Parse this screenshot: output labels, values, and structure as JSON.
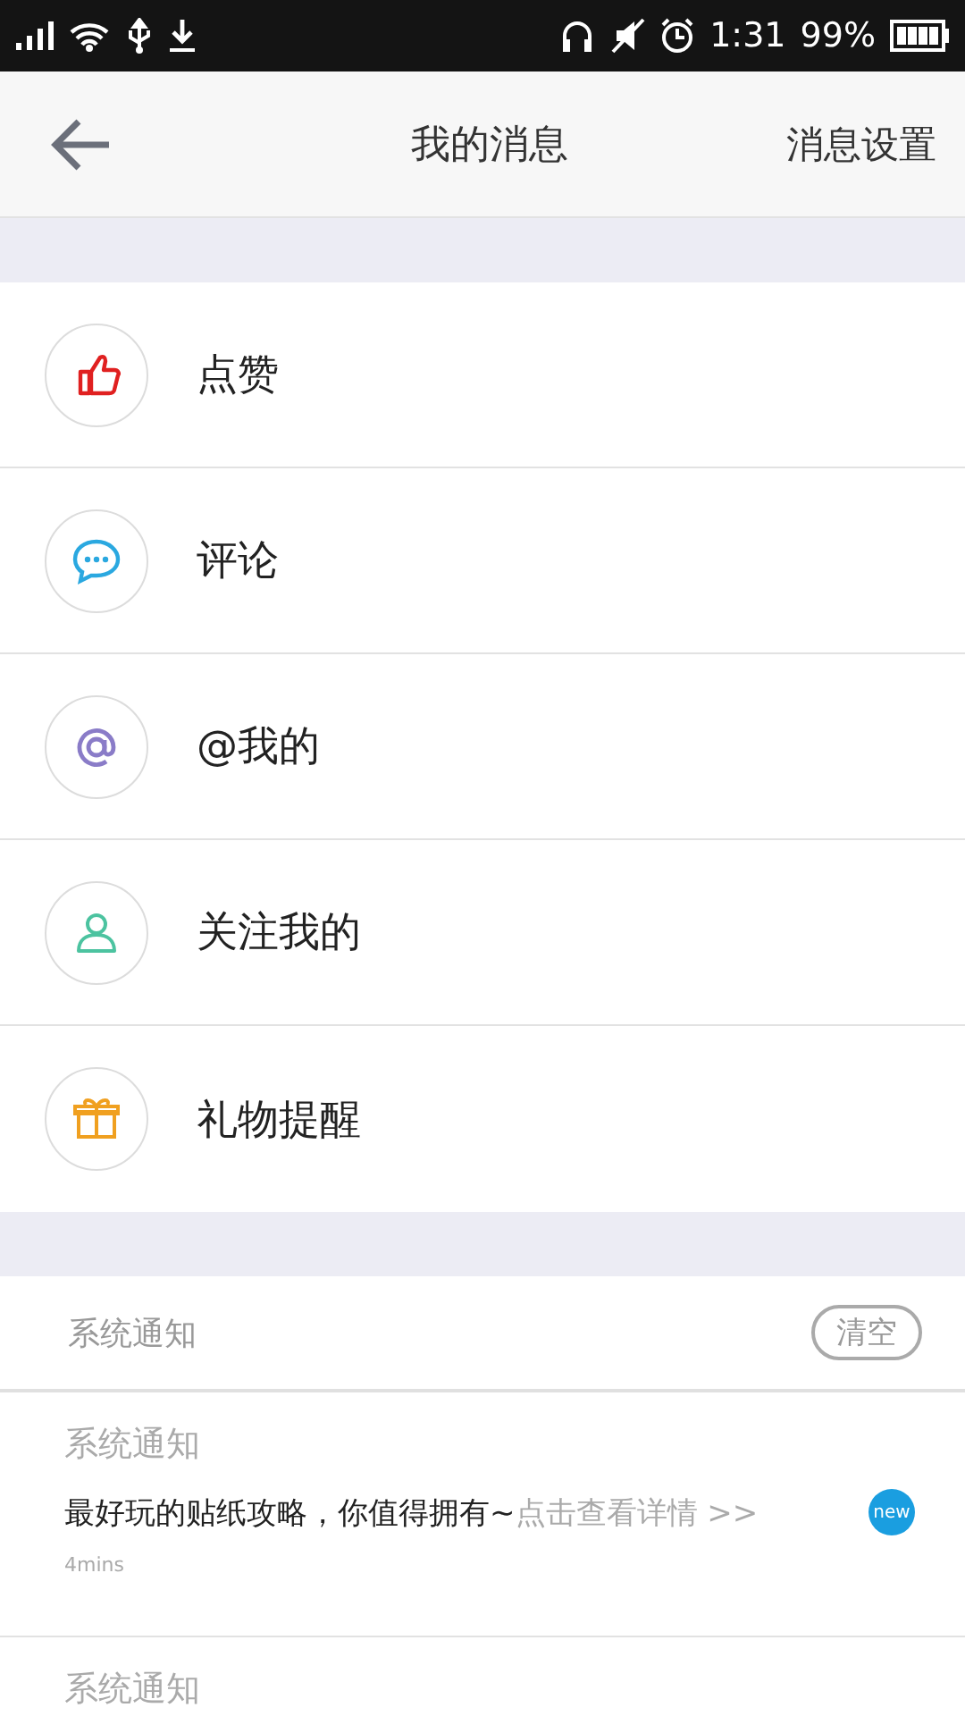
{
  "status_bar": {
    "time": "1:31",
    "battery": "99%"
  },
  "header": {
    "title": "我的消息",
    "action": "消息设置"
  },
  "menu": [
    {
      "label": "点赞",
      "kind": "like",
      "color": "#e02020"
    },
    {
      "label": "评论",
      "kind": "comment",
      "color": "#2aa8e0"
    },
    {
      "label": "@我的",
      "kind": "mention",
      "color": "#8a7cc8"
    },
    {
      "label": "关注我的",
      "kind": "follow",
      "color": "#4cc3a0"
    },
    {
      "label": "礼物提醒",
      "kind": "gift",
      "color": "#f0a020"
    }
  ],
  "system": {
    "title": "系统通知",
    "clear": "清空",
    "items": [
      {
        "title": "系统通知",
        "text": "最好玩的贴纸攻略，你值得拥有~",
        "link": "点击查看详情 >>",
        "time": "4mins",
        "badge": "new"
      },
      {
        "title": "系统通知"
      }
    ]
  }
}
